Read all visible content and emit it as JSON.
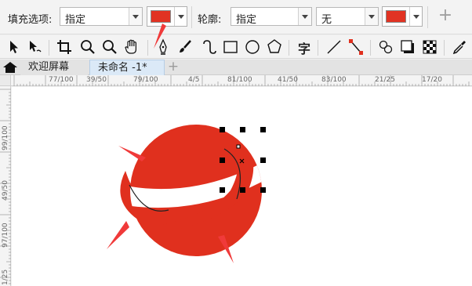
{
  "property_bar": {
    "fill_label": "填充选项:",
    "fill_value": "指定",
    "fill_color": "#e13323",
    "outline_label": "轮廓:",
    "outline_value": "指定",
    "outline_width": "无",
    "outline_color": "#e13323",
    "add_label": "+"
  },
  "toolbox": {
    "text_tool_glyph": "字",
    "icons": [
      "pick-tool",
      "freehand-pick-tool",
      "crop-tool",
      "zoom-tool",
      "zoom-out-tool",
      "pan-tool",
      "pen-tool",
      "brush-tool",
      "spiral-tool",
      "rectangle-tool",
      "ellipse-tool",
      "polygon-tool",
      "text-tool",
      "line-tool",
      "connector-tool",
      "blend-tool",
      "shadow-tool",
      "transparency-tool",
      "eyedropper-tool"
    ]
  },
  "tabs": {
    "welcome": "欢迎屏幕",
    "document": "未命名 -1*",
    "add": "+"
  },
  "ruler": {
    "h_labels": [
      "77/100",
      "39/50",
      "79/100",
      "4/5",
      "81/100",
      "41/50",
      "83/100",
      "21/25",
      "17/20"
    ],
    "v_labels": [
      "99/100",
      "49/50",
      "97/100",
      "1/25"
    ]
  },
  "artwork": {
    "planet_color": "#e0301e",
    "arrow_color": "#f03a3a",
    "ring_color": "#ffffff"
  }
}
